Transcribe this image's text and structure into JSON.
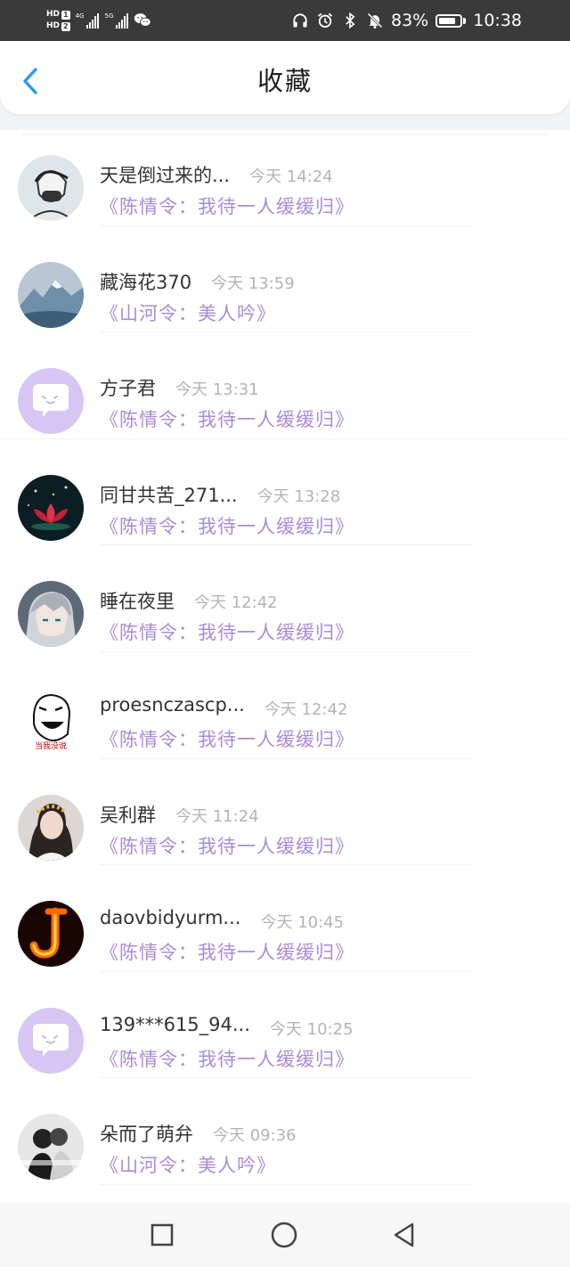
{
  "status_bar": {
    "hd1": "HD",
    "hd1_num": "1",
    "hd2": "HD",
    "hd2_num": "2",
    "net1": "4G",
    "net2": "5G",
    "battery_text": "83%",
    "battery_level": 0.83,
    "time": "10:38",
    "icons": [
      "headphones-icon",
      "alarm-icon",
      "bluetooth-icon",
      "mute-bell-icon",
      "battery-icon"
    ]
  },
  "header": {
    "title": "收藏",
    "back_icon": "chevron-left-icon",
    "accent": "#2b9af3"
  },
  "colors": {
    "name": "#333333",
    "time": "#b4b4b4",
    "work": "#a98bd6",
    "default_avatar": "#d6c3f2"
  },
  "items": [
    {
      "name": "天是倒过来的...",
      "time": "今天 14:24",
      "work": "《陈情令：我待一人缓缓归》",
      "avatar": "sketch-portrait"
    },
    {
      "name": "藏海花370",
      "time": "今天 13:59",
      "work": "《山河令：美人吟》",
      "avatar": "snow-mountain"
    },
    {
      "name": "方子君",
      "time": "今天 13:31",
      "work": "《陈情令：我待一人缓缓归》",
      "avatar": "default-chat"
    },
    {
      "name": "同甘共苦_271...",
      "time": "今天 13:28",
      "work": "《陈情令：我待一人缓缓归》",
      "avatar": "lotus"
    },
    {
      "name": "睡在夜里",
      "time": "今天 12:42",
      "work": "《陈情令：我待一人缓缓归》",
      "avatar": "anime-boy"
    },
    {
      "name": "proesnczascp...",
      "time": "今天 12:42",
      "work": "《陈情令：我待一人缓缓归》",
      "avatar": "meme-face"
    },
    {
      "name": "吴利群",
      "time": "今天 11:24",
      "work": "《陈情令：我待一人缓缓归》",
      "avatar": "girl-photo"
    },
    {
      "name": "daovbidyurm...",
      "time": "今天 10:45",
      "work": "《陈情令：我待一人缓缓归》",
      "avatar": "fire-letter"
    },
    {
      "name": "139***615_94...",
      "time": "今天 10:25",
      "work": "《陈情令：我待一人缓缓归》",
      "avatar": "default-chat"
    },
    {
      "name": "朵而了萌弁",
      "time": "今天 09:36",
      "work": "《山河令：美人吟》",
      "avatar": "couple-bw"
    }
  ],
  "nav": [
    "square-recent-icon",
    "circle-home-icon",
    "triangle-back-icon"
  ]
}
